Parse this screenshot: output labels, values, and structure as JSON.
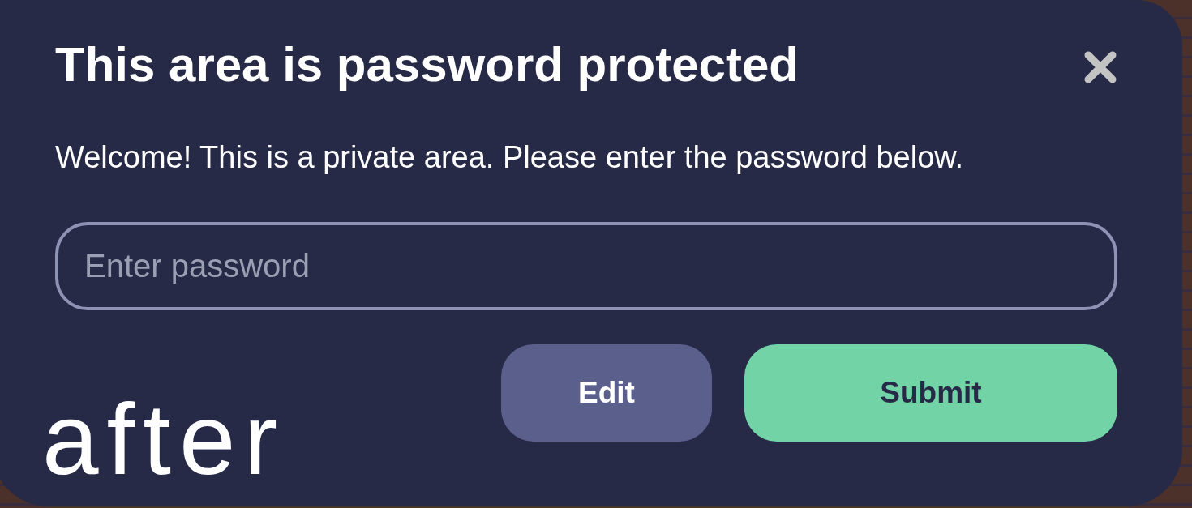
{
  "dialog": {
    "title": "This area is password protected",
    "message": "Welcome! This is a private area. Please enter the password below.",
    "password_field": {
      "placeholder": "Enter password"
    },
    "buttons": [
      {
        "label": "Edit",
        "kind": "secondary"
      },
      {
        "label": "Submit",
        "kind": "primary"
      }
    ]
  },
  "annotation": {
    "text": "after"
  }
}
